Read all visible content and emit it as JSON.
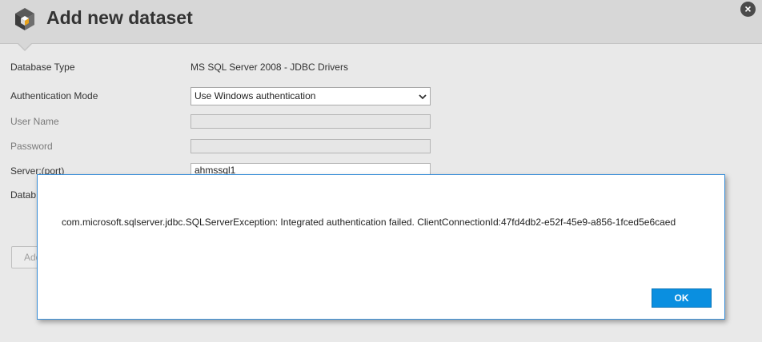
{
  "window": {
    "title": "Add new dataset",
    "close_label": "×"
  },
  "form": {
    "database_type": {
      "label": "Database Type",
      "value": "MS SQL Server 2008 - JDBC Drivers"
    },
    "authentication_mode": {
      "label": "Authentication Mode",
      "selected": "Use Windows authentication"
    },
    "user_name": {
      "label": "User Name",
      "value": ""
    },
    "password": {
      "label": "Password",
      "value": ""
    },
    "server": {
      "label": "Server:(port)",
      "value": "ahmssql1"
    },
    "database": {
      "label": "Datab"
    },
    "add_button_label": "Add"
  },
  "error_dialog": {
    "message": "com.microsoft.sqlserver.jdbc.SQLServerException: Integrated authentication failed. ClientConnectionId:47fd4db2-e52f-45e9-a856-1fced5e6caed",
    "ok_label": "OK"
  },
  "colors": {
    "accent": "#0a8fe0",
    "modal_border": "#3a8fd8",
    "icon_accent": "#e8a21a"
  },
  "icons": {
    "app": "dataset-cube-icon",
    "close": "close-icon",
    "dropdown": "chevron-down-icon"
  }
}
